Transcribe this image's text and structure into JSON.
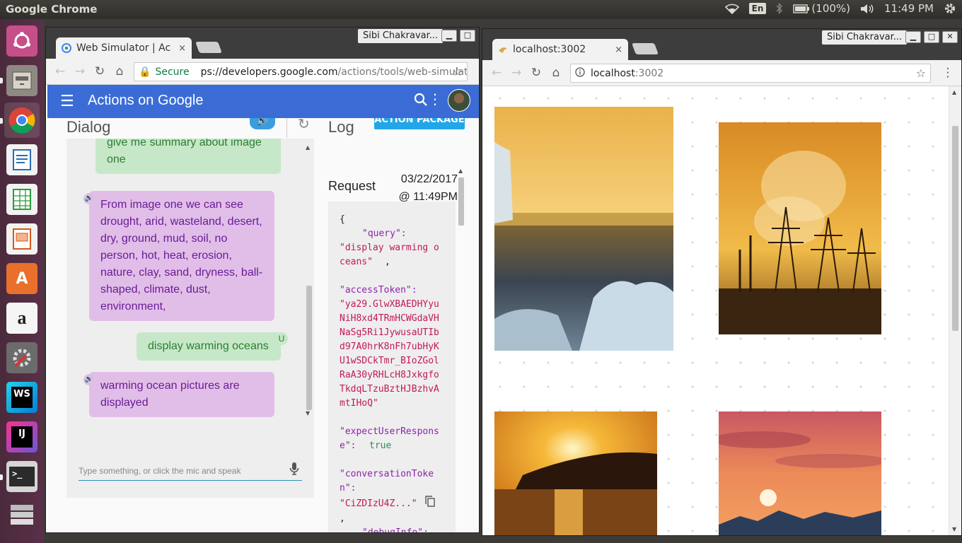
{
  "system": {
    "app_title": "Google Chrome",
    "keyboard_layout": "En",
    "battery": "(100%)",
    "clock": "11:49 PM"
  },
  "launcher": {
    "items": [
      "ubuntu",
      "files",
      "chrome",
      "writer",
      "calc",
      "impress",
      "software-center",
      "amazon",
      "system-settings",
      "webstorm",
      "intellij",
      "terminal",
      "workspaces"
    ]
  },
  "left_window": {
    "tab_title": "Web Simulator | Ac",
    "tab_close": "×",
    "profile": "Sibi Chakravar...",
    "secure_label": "Secure",
    "url_visible": "ps://developers.google.com",
    "url_path": "/actions/tools/web-simulator",
    "app_bar_title": "Actions on Google",
    "dialog_heading": "Dialog",
    "log_heading": "Log",
    "action_package_button": "ACTION PACKAGE",
    "messages": [
      {
        "role": "user",
        "text": "give me summary about image one"
      },
      {
        "role": "bot",
        "text": "From image one we can see drought, arid, wasteland, desert, dry, ground, mud, soil, no person, hot, heat, erosion, nature, clay, sand, dryness, ball-shaped, climate, dust, environment,"
      },
      {
        "role": "user",
        "text": "display warming oceans",
        "badge": "U"
      },
      {
        "role": "bot",
        "text": "warming ocean pictures are displayed"
      }
    ],
    "input_placeholder": "Type something, or click the mic and speak",
    "request_heading": "Request",
    "request_date": "03/22/2017",
    "request_time": "@ 11:49PM",
    "code": {
      "open": "{",
      "query_key": "\"query\":",
      "query_val": "\"display warming oceans\"",
      "access_key": "\"accessToken\":",
      "access_val": "\"ya29.GlwXBAEDHYyuNiH8xd4TRmHCWGdaVHNaSg5Ri1JywusaUTIbd97A0hrK8nFh7ubHyKU1wSDCkTmr_BIoZGolRaA30yRHLcH8JxkgfoTkdqLTzuBztHJBzhvAmtIHoQ\"",
      "expect_key": "\"expectUserResponse\":",
      "expect_val": "true",
      "conv_key": "\"conversationToken\":",
      "conv_val": "\"CiZDIzU4Z...\"",
      "debug_key": "\"debugInfo\":",
      "debug_open": "{"
    }
  },
  "right_window": {
    "tab_title": "localhost:3002",
    "tab_close": "×",
    "profile": "Sibi Chakravar...",
    "url_host": "localhost",
    "url_port": ":3002",
    "images": [
      "iceberg-sunset-sea",
      "power-lines-smoke-sunset",
      "coastal-sunset-reflection",
      "pink-sky-sunset-clouds"
    ]
  },
  "colors": {
    "aog_blue": "#3b6cd6",
    "user_bubble": "#c6e8c8",
    "bot_bubble": "#e1bee7",
    "launcher": "#4b2a3c"
  }
}
